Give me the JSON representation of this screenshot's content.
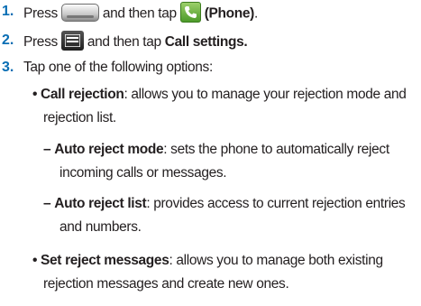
{
  "steps": [
    {
      "number": "1.",
      "parts": {
        "press": "Press",
        "then_tap": "and then tap",
        "phone_label": "(Phone)",
        "end": "."
      },
      "icons": [
        "home-key-icon",
        "phone-app-icon"
      ]
    },
    {
      "number": "2.",
      "parts": {
        "press": "Press",
        "then_tap": "and then tap",
        "target": "Call settings."
      },
      "icons": [
        "menu-key-icon"
      ]
    },
    {
      "number": "3.",
      "text": "Tap one of the following options:"
    }
  ],
  "options": [
    {
      "bullet": "•",
      "title": "Call rejection",
      "desc_line1": ": allows you to manage your rejection mode and",
      "desc_line2": "rejection list.",
      "sub": [
        {
          "dash": "–",
          "title": "Auto reject mode",
          "desc_line1": ": sets the phone to automatically reject",
          "desc_line2": "incoming calls or messages."
        },
        {
          "dash": "–",
          "title": "Auto reject list",
          "desc_line1": ": provides access to current rejection entries",
          "desc_line2": "and numbers."
        }
      ]
    },
    {
      "bullet": "•",
      "title": "Set reject messages",
      "desc_line1": ": allows you to manage both existing",
      "desc_line2": "rejection messages and create new ones."
    }
  ],
  "colors": {
    "step_number": "#0a6eb4",
    "text": "#231f20",
    "phone_icon": "#4c9a2a"
  }
}
